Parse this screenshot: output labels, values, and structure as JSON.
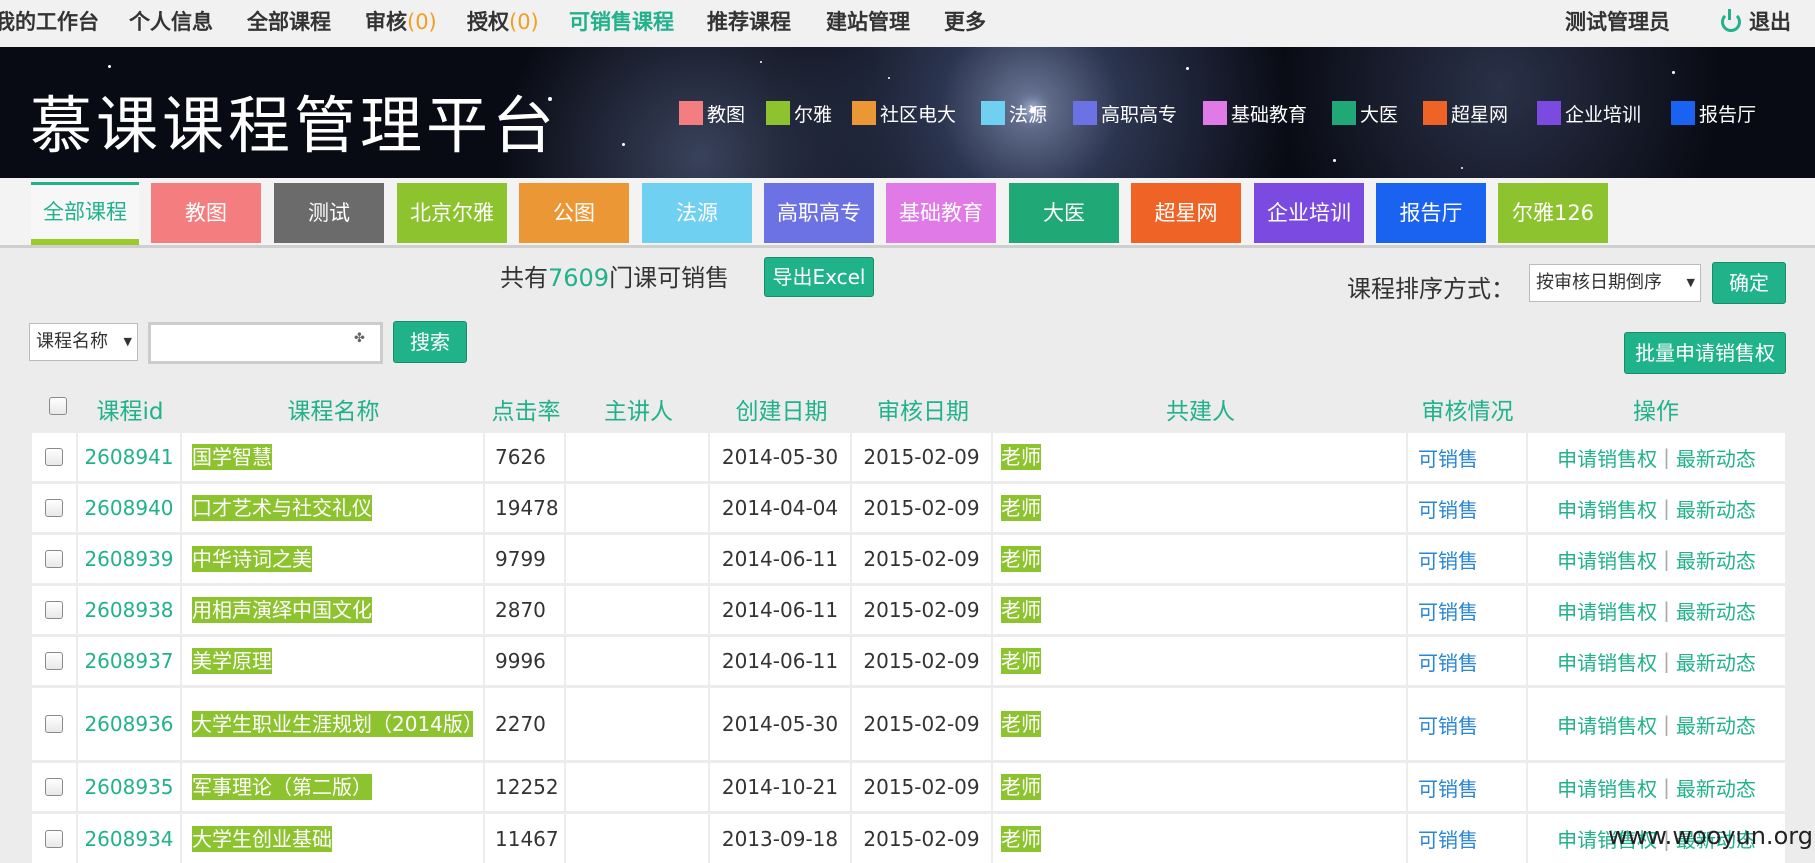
{
  "topnav": {
    "items": [
      {
        "label": "我的工作台",
        "count": null
      },
      {
        "label": "个人信息",
        "count": null
      },
      {
        "label": "全部课程",
        "count": null
      },
      {
        "label": "审核",
        "count": "(0)"
      },
      {
        "label": "授权",
        "count": "(0)"
      },
      {
        "label": "可销售课程",
        "count": null
      },
      {
        "label": "推荐课程",
        "count": null
      },
      {
        "label": "建站管理",
        "count": null
      },
      {
        "label": "更多",
        "count": null
      }
    ],
    "user": "测试管理员",
    "logout": "退出"
  },
  "banner": {
    "logo": "慕课课程管理平台",
    "legend": [
      {
        "label": "教图",
        "color": "#f47e7f"
      },
      {
        "label": "尔雅",
        "color": "#8dc32f"
      },
      {
        "label": "社区电大",
        "color": "#ec9736"
      },
      {
        "label": "法源",
        "color": "#6fd0f2"
      },
      {
        "label": "高职高专",
        "color": "#6c72e3"
      },
      {
        "label": "基础教育",
        "color": "#e07ae6"
      },
      {
        "label": "大医",
        "color": "#20a877"
      },
      {
        "label": "超星网",
        "color": "#ef6326"
      },
      {
        "label": "企业培训",
        "color": "#7b4ae0"
      },
      {
        "label": "报告厅",
        "color": "#1a62f0"
      }
    ]
  },
  "category_tabs": [
    {
      "label": "全部课程",
      "color": "#f7f7f7"
    },
    {
      "label": "教图",
      "color": "#f47e7f"
    },
    {
      "label": "测试",
      "color": "#6b6b6b"
    },
    {
      "label": "北京尔雅",
      "color": "#8dc32f"
    },
    {
      "label": "公图",
      "color": "#ec9736"
    },
    {
      "label": "法源",
      "color": "#6fd0f2"
    },
    {
      "label": "高职高专",
      "color": "#6c72e3"
    },
    {
      "label": "基础教育",
      "color": "#e07ae6"
    },
    {
      "label": "大医",
      "color": "#20a877"
    },
    {
      "label": "超星网",
      "color": "#ef6326"
    },
    {
      "label": "企业培训",
      "color": "#7b4ae0"
    },
    {
      "label": "报告厅",
      "color": "#1a62f0"
    },
    {
      "label": "尔雅126",
      "color": "#8dc32f"
    }
  ],
  "summary": {
    "prefix": "共有",
    "count": "7609",
    "suffix": "门课可销售"
  },
  "export_button": "导出Excel",
  "sort": {
    "label": "课程排序方式：",
    "selected": "按审核日期倒序",
    "confirm": "确定"
  },
  "search": {
    "field_selected": "课程名称",
    "value": "",
    "button": "搜索"
  },
  "batch_button": "批量申请销售权",
  "table": {
    "headers": [
      "课程id",
      "课程名称",
      "点击率",
      "主讲人",
      "创建日期",
      "审核日期",
      "共建人",
      "审核情况",
      "操作"
    ],
    "op_apply": "申请销售权",
    "op_sep": "|",
    "op_news": "最新动态",
    "rows": [
      {
        "id": "2608941",
        "name": "国学智慧",
        "clicks": "7626",
        "lecturer": "",
        "created": "2014-05-30",
        "audited": "2015-02-09",
        "cobuilder": "老师",
        "status": "可销售"
      },
      {
        "id": "2608940",
        "name": "口才艺术与社交礼仪",
        "clicks": "19478",
        "lecturer": "",
        "created": "2014-04-04",
        "audited": "2015-02-09",
        "cobuilder": "老师",
        "status": "可销售"
      },
      {
        "id": "2608939",
        "name": "中华诗词之美",
        "clicks": "9799",
        "lecturer": "",
        "created": "2014-06-11",
        "audited": "2015-02-09",
        "cobuilder": "老师",
        "status": "可销售"
      },
      {
        "id": "2608938",
        "name": "用相声演绎中国文化",
        "clicks": "2870",
        "lecturer": "",
        "created": "2014-06-11",
        "audited": "2015-02-09",
        "cobuilder": "老师",
        "status": "可销售"
      },
      {
        "id": "2608937",
        "name": "美学原理",
        "clicks": "9996",
        "lecturer": "",
        "created": "2014-06-11",
        "audited": "2015-02-09",
        "cobuilder": "老师",
        "status": "可销售"
      },
      {
        "id": "2608936",
        "name": "大学生职业生涯规划（2014版）",
        "clicks": "2270",
        "lecturer": "",
        "created": "2014-05-30",
        "audited": "2015-02-09",
        "cobuilder": "老师",
        "status": "可销售"
      },
      {
        "id": "2608935",
        "name": "军事理论（第二版）",
        "clicks": "12252",
        "lecturer": "",
        "created": "2014-10-21",
        "audited": "2015-02-09",
        "cobuilder": "老师",
        "status": "可销售"
      },
      {
        "id": "2608934",
        "name": "大学生创业基础",
        "clicks": "11467",
        "lecturer": "",
        "created": "2013-09-18",
        "audited": "2015-02-09",
        "cobuilder": "老师",
        "status": "可销售"
      }
    ]
  },
  "watermark": "www.wooyun.org"
}
